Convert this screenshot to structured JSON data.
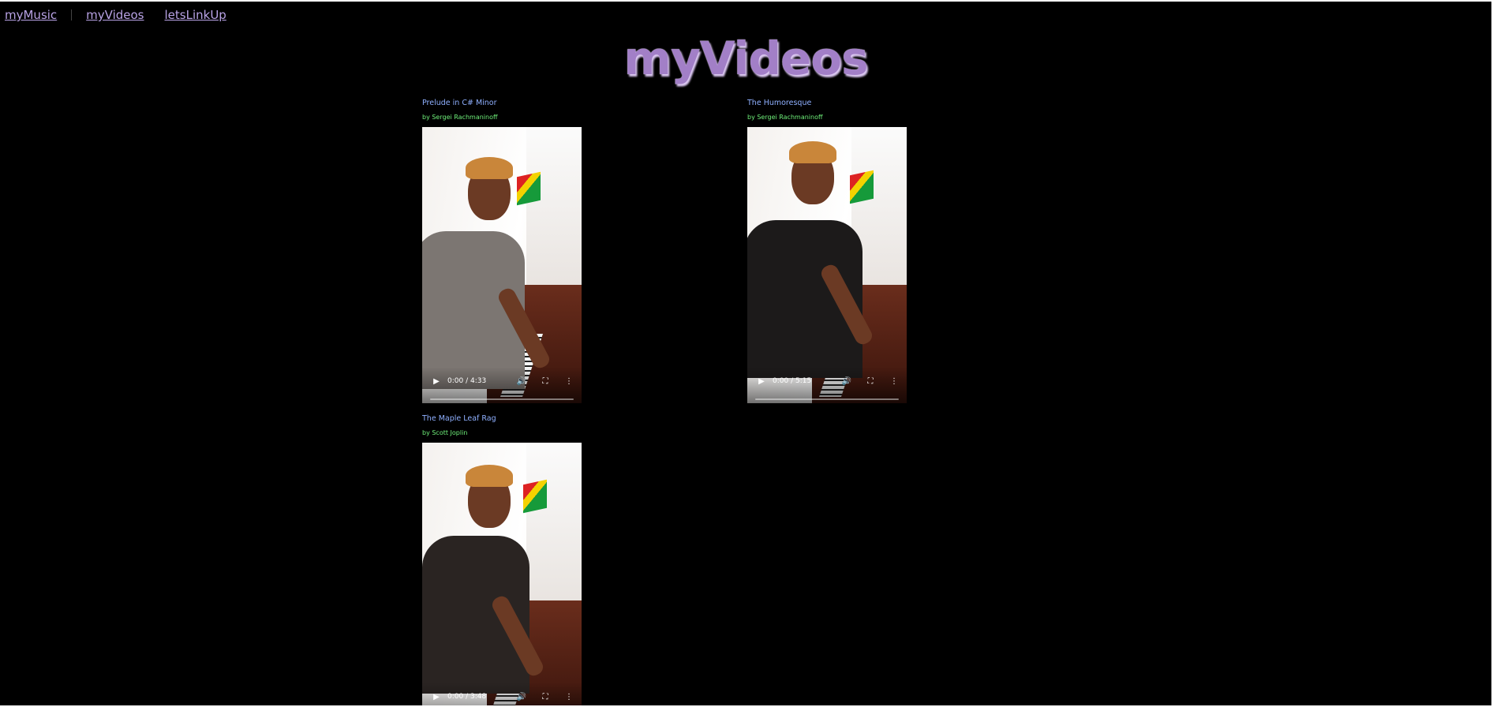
{
  "nav": {
    "items": [
      {
        "label": "myMusic"
      },
      {
        "label": "myVideos"
      },
      {
        "label": "letsLinkUp"
      }
    ]
  },
  "page": {
    "title": "myVideos"
  },
  "colors": {
    "background": "#000000",
    "title": "#a27fc7",
    "nav_link": "#b9a3e6",
    "video_title": "#8fb0ff",
    "video_artist": "#6ff07a"
  },
  "videos": [
    {
      "title": "Prelude in C# Minor",
      "artist": "by Sergei Rachmaninoff",
      "time": "0:00 / 4:33",
      "progress": 0
    },
    {
      "title": "The Humoresque",
      "artist": "by Sergei Rachmaninoff",
      "time": "0:00 / 5:15",
      "progress": 0
    },
    {
      "title": "The Maple Leaf Rag",
      "artist": "by Scott Joplin",
      "time": "0:00 / 3:48",
      "progress": 0
    }
  ],
  "icons": {
    "play": "play-icon",
    "volume": "volume-icon",
    "fullscreen": "fullscreen-icon",
    "more": "more-options-icon"
  }
}
